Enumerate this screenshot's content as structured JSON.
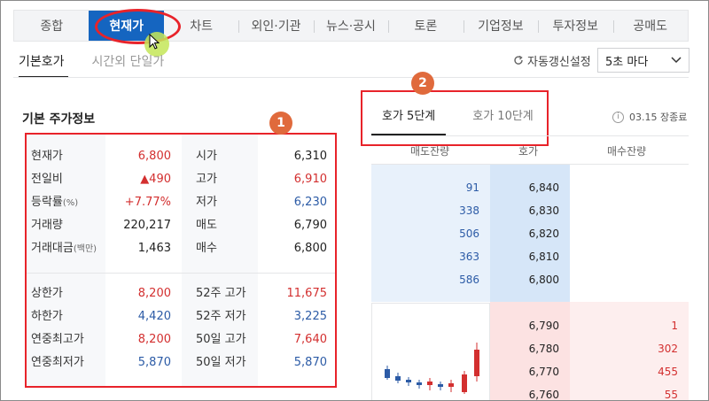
{
  "top_tabs": [
    "종합",
    "현재가",
    "차트",
    "외인·기관",
    "뉴스·공시",
    "토론",
    "기업정보",
    "투자정보",
    "공매도"
  ],
  "sub_tabs": [
    "기본호가",
    "시간외 단일가"
  ],
  "refresh_label": "자동갱신설정",
  "interval_value": "5초 마다",
  "section_title": "기본 주가정보",
  "annotations": {
    "badge1": "1",
    "badge2": "2"
  },
  "info_rows": [
    {
      "l1": "현재가",
      "l1s": "",
      "v1": "6,800",
      "l2": "시가",
      "v2": "6,310"
    },
    {
      "l1": "전일비",
      "l1s": "",
      "v1": "▲490",
      "l2": "고가",
      "v2": "6,910"
    },
    {
      "l1": "등락률",
      "l1s": "(%)",
      "v1": "+7.77%",
      "l2": "저가",
      "v2": "6,230"
    },
    {
      "l1": "거래량",
      "l1s": "",
      "v1": "220,217",
      "l2": "매도",
      "v2": "6,790"
    },
    {
      "l1": "거래대금",
      "l1s": "(백만)",
      "v1": "1,463",
      "l2": "매수",
      "v2": "6,800"
    },
    {
      "l1": "상한가",
      "l1s": "",
      "v1": "8,200",
      "l2": "52주 고가",
      "v2": "11,675"
    },
    {
      "l1": "하한가",
      "l1s": "",
      "v1": "4,420",
      "l2": "52주 저가",
      "v2": "3,225"
    },
    {
      "l1": "연중최고가",
      "l1s": "",
      "v1": "8,200",
      "l2": "50일 고가",
      "v2": "7,640"
    },
    {
      "l1": "연중최저가",
      "l1s": "",
      "v1": "5,870",
      "l2": "50일 저가",
      "v2": "5,870"
    }
  ],
  "hoga_tabs": [
    "호가 5단계",
    "호가 10단계"
  ],
  "market_status": "03.15 장종료",
  "orderbook_header": {
    "ask": "매도잔량",
    "price": "호가",
    "bid": "매수잔량"
  },
  "asks": [
    {
      "vol": "91",
      "price": "6,840"
    },
    {
      "vol": "338",
      "price": "6,830"
    },
    {
      "vol": "506",
      "price": "6,820"
    },
    {
      "vol": "363",
      "price": "6,810"
    },
    {
      "vol": "586",
      "price": "6,800"
    }
  ],
  "bids": [
    {
      "price": "6,790",
      "vol": "1"
    },
    {
      "price": "6,780",
      "vol": "302"
    },
    {
      "price": "6,770",
      "vol": "455"
    },
    {
      "price": "6,760",
      "vol": "55"
    }
  ],
  "colors": {
    "accent": "#1565c0",
    "up": "#d32f2f",
    "down": "#2c5ba6",
    "highlight": "#e8232a",
    "badge": "#e06a3c"
  }
}
